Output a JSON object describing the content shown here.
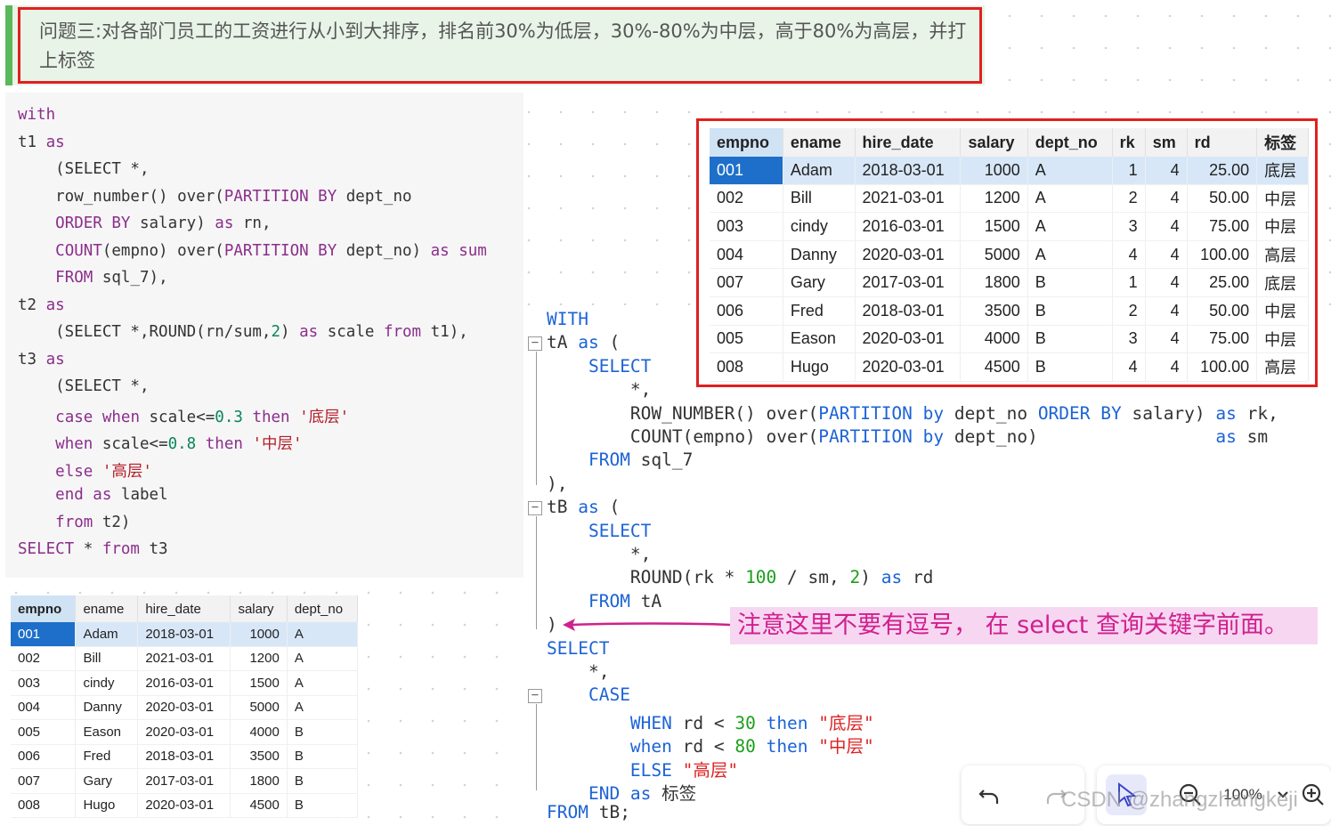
{
  "banner": {
    "text": "问题三:对各部门员工的工资进行从小到大排序，排名前30%为低层，30%-80%为中层，高于80%为高层，并打上标签"
  },
  "left_code": [
    [
      [
        "kw2",
        "with"
      ]
    ],
    [
      [
        "",
        "t1 "
      ],
      [
        "kw2",
        "as"
      ]
    ],
    [
      [
        "",
        "    (SELECT *,"
      ]
    ],
    [
      [
        "",
        "    row_number() over("
      ],
      [
        "kw2",
        "PARTITION BY"
      ],
      [
        "",
        " dept_no"
      ]
    ],
    [
      [
        "",
        "    "
      ],
      [
        "kw2",
        "ORDER BY"
      ],
      [
        "",
        " salary) "
      ],
      [
        "kw2",
        "as"
      ],
      [
        "",
        " rn,"
      ]
    ],
    [
      [
        "",
        "    "
      ],
      [
        "kw2",
        "COUNT"
      ],
      [
        "",
        "(empno) over("
      ],
      [
        "kw2",
        "PARTITION BY"
      ],
      [
        "",
        " dept_no) "
      ],
      [
        "kw2",
        "as sum"
      ]
    ],
    [
      [
        "",
        "    "
      ],
      [
        "kw2",
        "FROM"
      ],
      [
        "",
        " sql_7),"
      ]
    ],
    [
      [
        "",
        "t2 "
      ],
      [
        "kw2",
        "as"
      ]
    ],
    [
      [
        "",
        "    (SELECT *,ROUND(rn/sum,"
      ],
      [
        "num",
        "2"
      ],
      [
        "",
        ") "
      ],
      [
        "kw2",
        "as"
      ],
      [
        "",
        " scale "
      ],
      [
        "kw2",
        "from"
      ],
      [
        "",
        " t1),"
      ]
    ],
    [
      [
        "",
        "t3 "
      ],
      [
        "kw2",
        "as"
      ]
    ],
    [
      [
        "",
        "    (SELECT *,"
      ]
    ],
    [
      [
        "",
        "    "
      ],
      [
        "kw2",
        "case when"
      ],
      [
        "",
        " scale<="
      ],
      [
        "num",
        "0.3"
      ],
      [
        "",
        " "
      ],
      [
        "kw2",
        "then"
      ],
      [
        "",
        " "
      ],
      [
        "str",
        "'底层'"
      ]
    ],
    [
      [
        "",
        "    "
      ],
      [
        "kw2",
        "when"
      ],
      [
        "",
        " scale<="
      ],
      [
        "num",
        "0.8"
      ],
      [
        "",
        " "
      ],
      [
        "kw2",
        "then"
      ],
      [
        "",
        " "
      ],
      [
        "str",
        "'中层'"
      ]
    ],
    [
      [
        "",
        "    "
      ],
      [
        "kw2",
        "else"
      ],
      [
        "",
        " "
      ],
      [
        "str",
        "'高层'"
      ]
    ],
    [
      [
        "",
        "    "
      ],
      [
        "kw2",
        "end as"
      ],
      [
        "",
        " label"
      ]
    ],
    [
      [
        "",
        "    "
      ],
      [
        "kw2",
        "from"
      ],
      [
        "",
        " t2)"
      ]
    ],
    [
      [
        "kw2",
        "SELECT"
      ],
      [
        "",
        " * "
      ],
      [
        "kw2",
        "from"
      ],
      [
        "",
        " t3"
      ]
    ]
  ],
  "left_table": {
    "headers": [
      "empno",
      "ename",
      "hire_date",
      "salary",
      "dept_no"
    ],
    "rows": [
      [
        "001",
        "Adam",
        "2018-03-01",
        "1000",
        "A"
      ],
      [
        "002",
        "Bill",
        "2021-03-01",
        "1200",
        "A"
      ],
      [
        "003",
        "cindy",
        "2016-03-01",
        "1500",
        "A"
      ],
      [
        "004",
        "Danny",
        "2020-03-01",
        "5000",
        "A"
      ],
      [
        "005",
        "Eason",
        "2020-03-01",
        "4000",
        "B"
      ],
      [
        "006",
        "Fred",
        "2018-03-01",
        "3500",
        "B"
      ],
      [
        "007",
        "Gary",
        "2017-03-01",
        "1800",
        "B"
      ],
      [
        "008",
        "Hugo",
        "2020-03-01",
        "4500",
        "B"
      ]
    ]
  },
  "right_code": [
    [
      [
        "b",
        "WITH"
      ]
    ],
    [
      [
        "",
        "tA "
      ],
      [
        "b",
        "as"
      ],
      [
        "",
        " ("
      ]
    ],
    [
      [
        "",
        "    "
      ],
      [
        "b",
        "SELECT"
      ]
    ],
    [
      [
        "",
        "        *,"
      ]
    ],
    [
      [
        "",
        "        ROW_NUMBER() over("
      ],
      [
        "b",
        "PARTITION by"
      ],
      [
        "",
        " dept_no "
      ],
      [
        "b",
        "ORDER BY"
      ],
      [
        "",
        " salary) "
      ],
      [
        "b",
        "as"
      ],
      [
        "",
        " rk,"
      ]
    ],
    [
      [
        "",
        "        COUNT(empno) over("
      ],
      [
        "b",
        "PARTITION by"
      ],
      [
        "",
        " dept_no)                 "
      ],
      [
        "b",
        "as"
      ],
      [
        "",
        " sm"
      ]
    ],
    [
      [
        "",
        "    "
      ],
      [
        "b",
        "FROM"
      ],
      [
        "",
        " sql_7"
      ]
    ],
    [
      [
        "",
        "),"
      ]
    ],
    [
      [
        "",
        "tB "
      ],
      [
        "b",
        "as"
      ],
      [
        "",
        " ("
      ]
    ],
    [
      [
        "",
        "    "
      ],
      [
        "b",
        "SELECT"
      ]
    ],
    [
      [
        "",
        "        *,"
      ]
    ],
    [
      [
        "",
        "        ROUND(rk * "
      ],
      [
        "g",
        "100"
      ],
      [
        "",
        " / sm, "
      ],
      [
        "g",
        "2"
      ],
      [
        "",
        ") "
      ],
      [
        "b",
        "as"
      ],
      [
        "",
        " rd"
      ]
    ],
    [
      [
        "",
        "    "
      ],
      [
        "b",
        "FROM"
      ],
      [
        "",
        " tA"
      ]
    ],
    [
      [
        "",
        ")"
      ]
    ],
    [
      [
        "b",
        "SELECT"
      ]
    ],
    [
      [
        "",
        "    *,"
      ]
    ],
    [
      [
        "",
        "    "
      ],
      [
        "b",
        "CASE"
      ]
    ],
    [
      [
        "",
        "        "
      ],
      [
        "b",
        "WHEN"
      ],
      [
        "",
        " rd < "
      ],
      [
        "g",
        "30"
      ],
      [
        "",
        " "
      ],
      [
        "b",
        "then"
      ],
      [
        "",
        " "
      ],
      [
        "rs",
        "\"底层\""
      ]
    ],
    [
      [
        "",
        "        "
      ],
      [
        "b",
        "when"
      ],
      [
        "",
        " rd < "
      ],
      [
        "g",
        "80"
      ],
      [
        "",
        " "
      ],
      [
        "b",
        "then"
      ],
      [
        "",
        " "
      ],
      [
        "rs",
        "\"中层\""
      ]
    ],
    [
      [
        "",
        "        "
      ],
      [
        "b",
        "ELSE"
      ],
      [
        "",
        " "
      ],
      [
        "rs",
        "\"高层\""
      ]
    ],
    [
      [
        "",
        "    "
      ],
      [
        "b",
        "END as"
      ],
      [
        "",
        " 标签"
      ]
    ],
    [
      [
        "b",
        "FROM"
      ],
      [
        "",
        " tB;"
      ]
    ]
  ],
  "note": {
    "text": "注意这里不要有逗号， 在 select 查询关键字前面。"
  },
  "right_table": {
    "headers": [
      "empno",
      "ename",
      "hire_date",
      "salary",
      "dept_no",
      "rk",
      "sm",
      "rd",
      "标签"
    ],
    "rows": [
      [
        "001",
        "Adam",
        "2018-03-01",
        "1000",
        "A",
        "1",
        "4",
        "25.00",
        "底层"
      ],
      [
        "002",
        "Bill",
        "2021-03-01",
        "1200",
        "A",
        "2",
        "4",
        "50.00",
        "中层"
      ],
      [
        "003",
        "cindy",
        "2016-03-01",
        "1500",
        "A",
        "3",
        "4",
        "75.00",
        "中层"
      ],
      [
        "004",
        "Danny",
        "2020-03-01",
        "5000",
        "A",
        "4",
        "4",
        "100.00",
        "高层"
      ],
      [
        "007",
        "Gary",
        "2017-03-01",
        "1800",
        "B",
        "1",
        "4",
        "25.00",
        "底层"
      ],
      [
        "006",
        "Fred",
        "2018-03-01",
        "3500",
        "B",
        "2",
        "4",
        "50.00",
        "中层"
      ],
      [
        "005",
        "Eason",
        "2020-03-01",
        "4000",
        "B",
        "3",
        "4",
        "75.00",
        "中层"
      ],
      [
        "008",
        "Hugo",
        "2020-03-01",
        "4500",
        "B",
        "4",
        "4",
        "100.00",
        "高层"
      ]
    ]
  },
  "toolbar": {
    "zoom_label": "100%",
    "icons": [
      "undo-icon",
      "redo-icon",
      "pointer-icon",
      "zoom-out-icon",
      "chevron-down-icon",
      "zoom-in-icon"
    ]
  },
  "watermark": "CSDN @zhangzhangkeji"
}
